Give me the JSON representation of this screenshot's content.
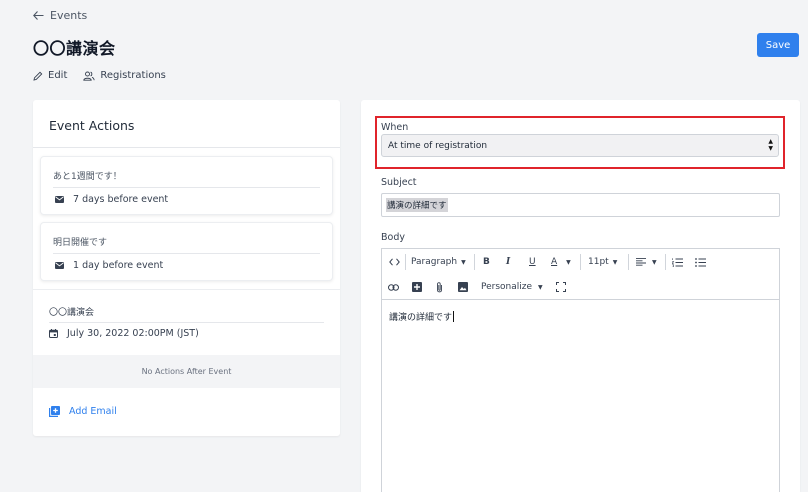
{
  "nav": {
    "back_label": "Events"
  },
  "header": {
    "title": "〇〇講演会",
    "save_label": "Save"
  },
  "subnav": {
    "edit_label": "Edit",
    "registrations_label": "Registrations"
  },
  "event_actions": {
    "title": "Event Actions",
    "before_actions": [
      {
        "name": "あと1週間です！",
        "timing": "7 days before event"
      },
      {
        "name": "明日開催です",
        "timing": "1 day before event"
      }
    ],
    "event": {
      "name": "〇〇講演会",
      "date": "July 30, 2022 02:00PM (JST)"
    },
    "no_after_label": "No Actions After Event",
    "add_email_label": "Add Email"
  },
  "form": {
    "when_label": "When",
    "when_value": "At time of registration",
    "subject_label": "Subject",
    "subject_value": "講演の詳細です",
    "body_label": "Body",
    "body_text": "講演の詳細です",
    "toolbar": {
      "paragraph_label": "Paragraph",
      "bold_label": "B",
      "italic_label": "I",
      "underline_label": "U",
      "font_color_label": "A",
      "font_size_label": "11pt",
      "personalize_label": "Personalize"
    }
  },
  "colors": {
    "accent": "#2f80ed",
    "highlight": "#e0242b"
  }
}
